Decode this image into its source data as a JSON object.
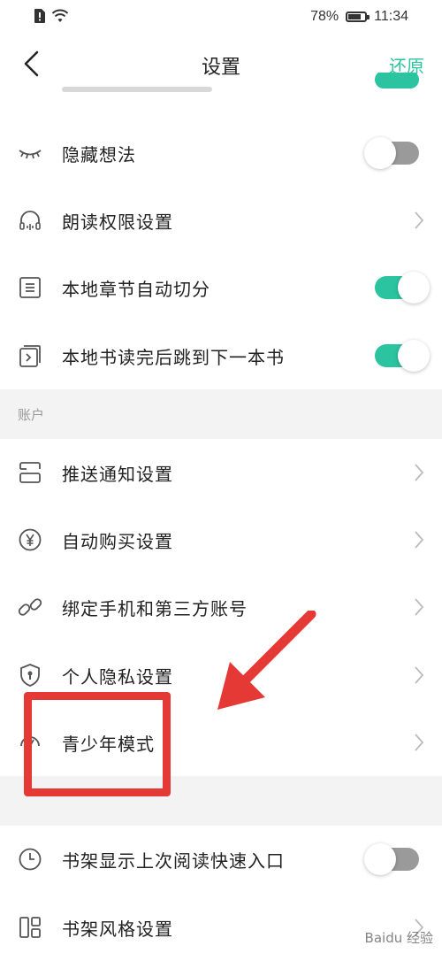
{
  "status_bar": {
    "battery": "78%",
    "time": "11:34",
    "battery_level": 0.78
  },
  "nav": {
    "title": "设置",
    "restore_label": "还原"
  },
  "rows_top": [
    {
      "label": "隐藏想法",
      "icon": "eye-closed-icon",
      "control": "toggle-off"
    },
    {
      "label": "朗读权限设置",
      "icon": "headphones-icon",
      "control": "chevron"
    },
    {
      "label": "本地章节自动切分",
      "icon": "document-lines-icon",
      "control": "toggle-on"
    },
    {
      "label": "本地书读完后跳到下一本书",
      "icon": "next-book-icon",
      "control": "toggle-on"
    }
  ],
  "section_account": {
    "title": "账户"
  },
  "rows_account": [
    {
      "label": "推送通知设置",
      "icon": "push-notification-icon",
      "control": "chevron"
    },
    {
      "label": "自动购买设置",
      "icon": "yen-icon",
      "control": "chevron"
    },
    {
      "label": "绑定手机和第三方账号",
      "icon": "link-icon",
      "control": "chevron"
    },
    {
      "label": "个人隐私设置",
      "icon": "shield-icon",
      "control": "chevron"
    },
    {
      "label": "青少年模式",
      "icon": "teen-mode-icon",
      "control": "chevron"
    }
  ],
  "rows_other": [
    {
      "label": "书架显示上次阅读快速入口",
      "icon": "clock-icon",
      "control": "toggle-off"
    },
    {
      "label": "书架风格设置",
      "icon": "bookshelf-layout-icon",
      "control": "chevron"
    }
  ],
  "watermark": "Baidu 经验",
  "colors": {
    "accent": "#2bc3a0",
    "annotation": "#e53935"
  }
}
